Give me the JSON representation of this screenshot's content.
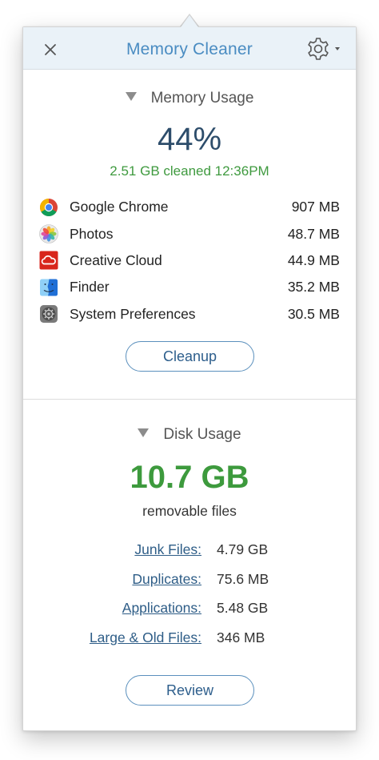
{
  "header": {
    "title": "Memory Cleaner"
  },
  "memory": {
    "section_title": "Memory Usage",
    "percent": "44%",
    "cleaned_text": "2.51 GB cleaned 12:36PM",
    "apps": [
      {
        "name": "Google Chrome",
        "size": "907 MB",
        "icon": "chrome-icon"
      },
      {
        "name": "Photos",
        "size": "48.7 MB",
        "icon": "photos-icon"
      },
      {
        "name": "Creative Cloud",
        "size": "44.9 MB",
        "icon": "creative-cloud-icon"
      },
      {
        "name": "Finder",
        "size": "35.2 MB",
        "icon": "finder-icon"
      },
      {
        "name": "System Preferences",
        "size": "30.5 MB",
        "icon": "system-preferences-icon"
      }
    ],
    "button_label": "Cleanup"
  },
  "disk": {
    "section_title": "Disk Usage",
    "total": "10.7 GB",
    "total_caption": "removable files",
    "items": [
      {
        "label": "Junk Files:",
        "value": "4.79 GB"
      },
      {
        "label": "Duplicates:",
        "value": "75.6 MB"
      },
      {
        "label": "Applications:",
        "value": "5.48 GB"
      },
      {
        "label": "Large & Old Files:",
        "value": "346 MB"
      }
    ],
    "button_label": "Review"
  },
  "colors": {
    "header_bg": "#eaf2f8",
    "title": "#4a8cc2",
    "percent": "#2d4d6b",
    "green": "#3d9a3d",
    "link": "#2e5d87"
  }
}
